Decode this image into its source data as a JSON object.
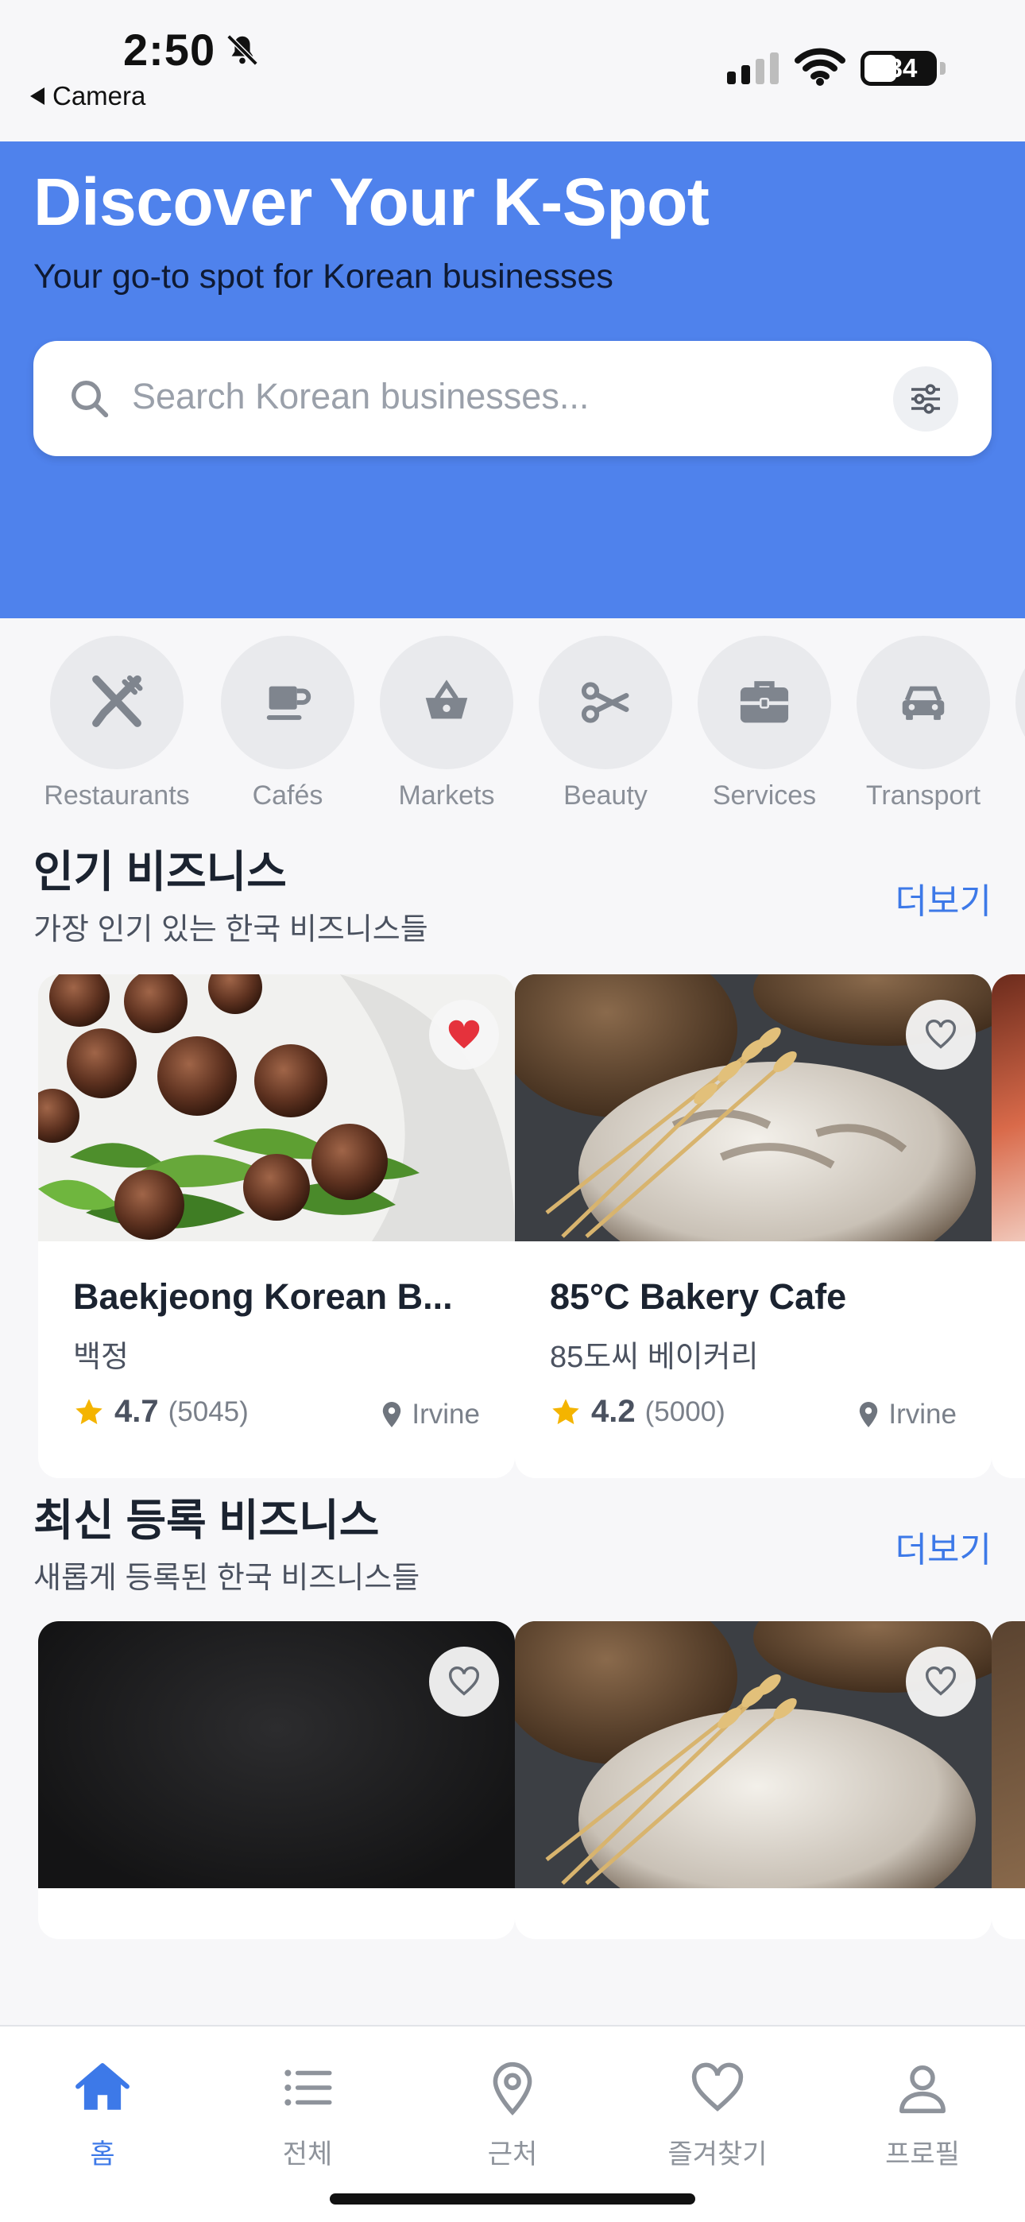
{
  "status": {
    "time": "2:50",
    "back_app": "Camera",
    "battery": "34"
  },
  "hero": {
    "title": "Discover Your K-Spot",
    "subtitle": "Your go-to spot for Korean businesses",
    "search_placeholder": "Search Korean businesses..."
  },
  "categories": [
    {
      "label": "Restaurants",
      "icon": "fork-knife-icon"
    },
    {
      "label": "Cafés",
      "icon": "coffee-cup-icon"
    },
    {
      "label": "Markets",
      "icon": "basket-icon"
    },
    {
      "label": "Beauty",
      "icon": "scissors-icon"
    },
    {
      "label": "Services",
      "icon": "briefcase-icon"
    },
    {
      "label": "Transport",
      "icon": "car-icon"
    }
  ],
  "popular": {
    "title": "인기 비즈니스",
    "subtitle": "가장 인기 있는 한국 비즈니스들",
    "more": "더보기",
    "cards": [
      {
        "name": "Baekjeong Korean B...",
        "korean_name": "백정",
        "rating": "4.7",
        "reviews": "(5045)",
        "location": "Irvine",
        "favorited": true
      },
      {
        "name": "85°C Bakery Cafe",
        "korean_name": "85도씨 베이커리",
        "rating": "4.2",
        "reviews": "(5000)",
        "location": "Irvine",
        "favorited": false
      }
    ]
  },
  "recent": {
    "title": "최신 등록 비즈니스",
    "subtitle": "새롭게 등록된 한국 비즈니스들",
    "more": "더보기"
  },
  "tabs": [
    {
      "label": "홈",
      "icon": "home-icon",
      "active": true
    },
    {
      "label": "전체",
      "icon": "list-icon",
      "active": false
    },
    {
      "label": "근처",
      "icon": "map-pin-icon",
      "active": false
    },
    {
      "label": "즐겨찾기",
      "icon": "heart-icon",
      "active": false
    },
    {
      "label": "프로필",
      "icon": "person-icon",
      "active": false
    }
  ],
  "colors": {
    "accent": "#4f82ec",
    "link": "#3d79e8",
    "favorite": "#e5323c",
    "star": "#f4b400"
  }
}
